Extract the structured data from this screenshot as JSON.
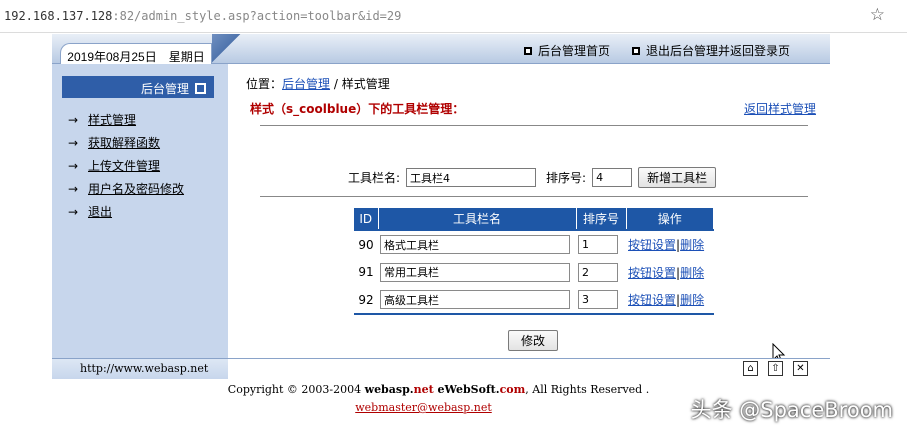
{
  "browser": {
    "url_host": "192.168.137.128",
    "url_rest": ":82/admin_style.asp?action=toolbar&id=29"
  },
  "header": {
    "date": "2019年08月25日　星期日",
    "links": [
      "后台管理首页",
      "退出后台管理并返回登录页"
    ]
  },
  "sidebar": {
    "title": "后台管理",
    "items": [
      {
        "label": "样式管理"
      },
      {
        "label": "获取解释函数"
      },
      {
        "label": "上传文件管理"
      },
      {
        "label": "用户名及密码修改"
      },
      {
        "label": "退出"
      }
    ]
  },
  "main": {
    "crumb_prefix": "位置：",
    "crumb_link": "后台管理",
    "crumb_sep": " / ",
    "crumb_current": "样式管理",
    "title": "样式（s_coolblue）下的工具栏管理：",
    "back_link": "返回样式管理",
    "add_form": {
      "name_label": "工具栏名:",
      "name_value": "工具栏4",
      "order_label": "排序号:",
      "order_value": "4",
      "add_button": "新增工具栏"
    },
    "table": {
      "headers": [
        "ID",
        "工具栏名",
        "排序号",
        "操作"
      ],
      "rows": [
        {
          "id": "90",
          "name": "格式工具栏",
          "order": "1",
          "op1": "按钮设置",
          "op2": "删除"
        },
        {
          "id": "91",
          "name": "常用工具栏",
          "order": "2",
          "op1": "按钮设置",
          "op2": "删除"
        },
        {
          "id": "92",
          "name": "高级工具栏",
          "order": "3",
          "op1": "按钮设置",
          "op2": "删除"
        }
      ],
      "op_sep": "|"
    },
    "submit_button": "修改"
  },
  "status": {
    "site_url": "http://www.webasp.net"
  },
  "footer": {
    "copy_prefix": "Copyright © 2003-2004 ",
    "brand1": "webasp.",
    "brand1b": "net",
    "brand2": " eWebSoft.",
    "brand2b": "com",
    "copy_suffix": ", All Rights Reserved .",
    "email": "webmaster@webasp.net"
  },
  "watermark": "头条 @SpaceBroom"
}
